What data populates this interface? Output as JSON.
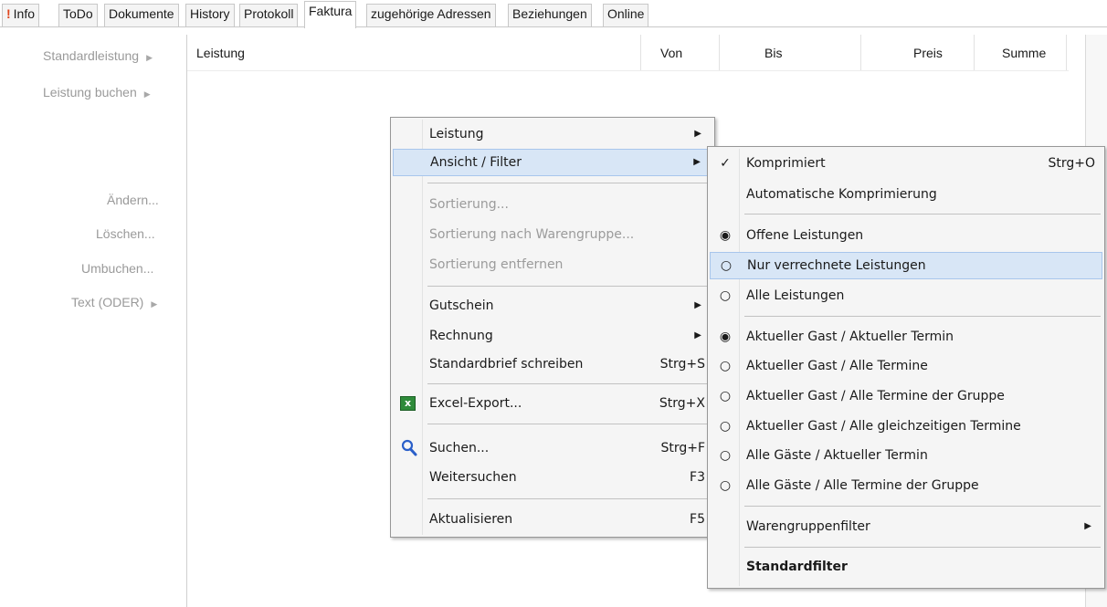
{
  "tabs": [
    {
      "label": "Info",
      "active": false
    },
    {
      "label": "ToDo",
      "active": false
    },
    {
      "label": "Dokumente",
      "active": false
    },
    {
      "label": "History",
      "active": false
    },
    {
      "label": "Protokoll",
      "active": false
    },
    {
      "label": "Faktura",
      "active": true
    },
    {
      "label": "zugehörige Adressen",
      "active": false
    },
    {
      "label": "Beziehungen",
      "active": false
    },
    {
      "label": "Online",
      "active": false
    }
  ],
  "left_panel": {
    "standardleistung": "Standardleistung",
    "leistung_buchen": "Leistung buchen",
    "aendern": "Ändern...",
    "loeschen": "Löschen...",
    "umbuchen": "Umbuchen...",
    "text_oder": "Text (ODER)"
  },
  "grid_columns": {
    "leistung": "Leistung",
    "von": "Von",
    "bis": "Bis",
    "preis": "Preis",
    "summe": "Summe"
  },
  "context_menu": {
    "leistung": "Leistung",
    "ansicht_filter": "Ansicht / Filter",
    "sortierung": "Sortierung...",
    "sortierung_warengruppe": "Sortierung nach Warengruppe...",
    "sortierung_entfernen": "Sortierung entfernen",
    "gutschein": "Gutschein",
    "rechnung": "Rechnung",
    "standardbrief": "Standardbrief schreiben",
    "standardbrief_shortcut": "Strg+S",
    "excel_export": "Excel-Export...",
    "excel_export_shortcut": "Strg+X",
    "suchen": "Suchen...",
    "suchen_shortcut": "Strg+F",
    "weitersuchen": "Weitersuchen",
    "weitersuchen_shortcut": "F3",
    "aktualisieren": "Aktualisieren",
    "aktualisieren_shortcut": "F5"
  },
  "filter_menu": {
    "komprimiert": "Komprimiert",
    "komprimiert_shortcut": "Strg+O",
    "auto_komprimierung": "Automatische Komprimierung",
    "offene_leistungen": "Offene Leistungen",
    "nur_verrechnete": "Nur verrechnete Leistungen",
    "alle_leistungen": "Alle Leistungen",
    "gast_termin": "Aktueller Gast / Aktueller Termin",
    "gast_alle_termine": "Aktueller Gast / Alle Termine",
    "gast_alle_termine_gruppe": "Aktueller Gast / Alle Termine der Gruppe",
    "gast_gleichzeitig": "Aktueller Gast / Alle gleichzeitigen Termine",
    "alle_gaeste_termin": "Alle Gäste / Aktueller Termin",
    "alle_gaeste_gruppe": "Alle Gäste / Alle Termine der Gruppe",
    "warengruppenfilter": "Warengruppenfilter",
    "standardfilter": "Standardfilter"
  },
  "colors": {
    "menu_bg": "#f5f5f5",
    "highlight": "#d8e6f6",
    "disabled_text": "#9b9b9b",
    "excel_green": "#2e8b3a",
    "search_blue": "#2a5fc9"
  }
}
